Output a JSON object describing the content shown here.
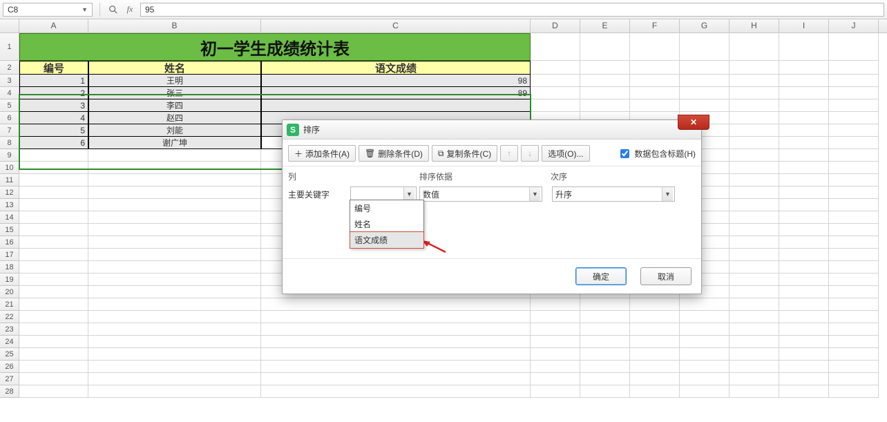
{
  "formula_bar": {
    "cell_ref": "C8",
    "formula": "95"
  },
  "columns": [
    "A",
    "B",
    "C",
    "D",
    "E",
    "F",
    "G",
    "H",
    "I",
    "J"
  ],
  "row_numbers": [
    1,
    2,
    3,
    4,
    5,
    6,
    7,
    8,
    9,
    10,
    11,
    12,
    13,
    14,
    15,
    16,
    17,
    18,
    19,
    20,
    21,
    22,
    23,
    24,
    25,
    26,
    27,
    28
  ],
  "sheet": {
    "title": "初一学生成绩统计表",
    "headers": {
      "id": "编号",
      "name": "姓名",
      "score": "语文成绩"
    },
    "rows": [
      {
        "id": 1,
        "name": "王明",
        "score": 98
      },
      {
        "id": 2,
        "name": "张三",
        "score": 89
      },
      {
        "id": 3,
        "name": "李四",
        "score": ""
      },
      {
        "id": 4,
        "name": "赵四",
        "score": ""
      },
      {
        "id": 5,
        "name": "刘能",
        "score": ""
      },
      {
        "id": 6,
        "name": "谢广坤",
        "score": ""
      }
    ]
  },
  "dialog": {
    "title": "排序",
    "toolbar": {
      "add": "添加条件(A)",
      "del": "删除条件(D)",
      "copy": "复制条件(C)",
      "options": "选项(O)...",
      "has_header": "数据包含标题(H)"
    },
    "cols": {
      "column": "列",
      "basis": "排序依据",
      "order": "次序"
    },
    "row": {
      "keylabel": "主要关键字",
      "column_value": "",
      "basis_value": "数值",
      "order_value": "升序"
    },
    "options_list": [
      "编号",
      "姓名",
      "语文成绩"
    ],
    "ok": "确定",
    "cancel": "取消"
  }
}
